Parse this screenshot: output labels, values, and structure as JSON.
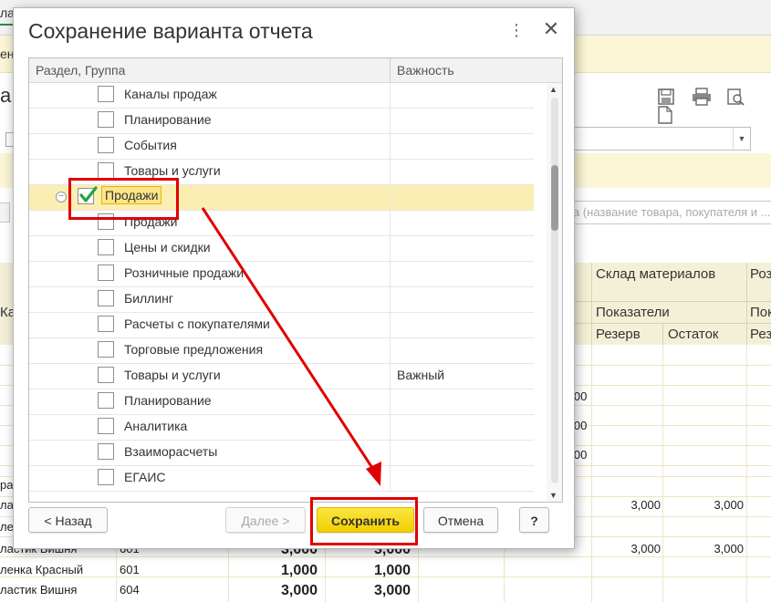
{
  "background": {
    "tab_label": "ла",
    "yellow_bar_text": "ен",
    "title_fragment": "а",
    "search_placeholder": "а (название товара, покупателя и ...",
    "grid_header": {
      "col_left": "Кар",
      "col_warehouse": "Склад материалов",
      "col_r": "Роз",
      "indicators": "Показатели",
      "indicators_r": "Пок",
      "reserve": "Резерв",
      "balance": "Остаток",
      "reserve_r": "Рез"
    },
    "rows": [
      {
        "name": "ра",
        "code": "",
        "v1": "",
        "v2": "",
        "w1": "",
        "w2": ""
      },
      {
        "name": "ла",
        "code": "",
        "v1": "",
        "v2": "",
        "w1": "3,000",
        "w2": "3,000"
      },
      {
        "name": "ле",
        "code": "",
        "v1": "",
        "v2": "",
        "w1": "",
        "w2": ""
      },
      {
        "name": "ластик Вишня",
        "code": "601",
        "v1": "3,000",
        "v2": "3,000",
        "w1": "3,000",
        "w2": "3,000"
      },
      {
        "name": "ленка Красный",
        "code": "601",
        "v1": "1,000",
        "v2": "1,000",
        "w1": "",
        "w2": ""
      },
      {
        "name": "ластик Вишня",
        "code": "604",
        "v1": "3,000",
        "v2": "3,000",
        "w1": "",
        "w2": ""
      }
    ],
    "partial_values": [
      ",000",
      ",000",
      ",000"
    ]
  },
  "dialog": {
    "title": "Сохранение варианта отчета",
    "more_icon": "⋮",
    "close_icon": "✕",
    "columns": {
      "section": "Раздел, Группа",
      "importance": "Важность"
    },
    "rows": [
      {
        "label": "Каналы продаж",
        "checked": false,
        "importance": "",
        "level": 2
      },
      {
        "label": "Планирование",
        "checked": false,
        "importance": "",
        "level": 2
      },
      {
        "label": "События",
        "checked": false,
        "importance": "",
        "level": 2
      },
      {
        "label": "Товары и услуги",
        "checked": false,
        "importance": "",
        "level": 2
      },
      {
        "label": "Продажи",
        "checked": true,
        "importance": "",
        "level": 1,
        "selected": true
      },
      {
        "label": "Продажи",
        "checked": false,
        "importance": "",
        "level": 2
      },
      {
        "label": "Цены и скидки",
        "checked": false,
        "importance": "",
        "level": 2
      },
      {
        "label": "Розничные продажи",
        "checked": false,
        "importance": "",
        "level": 2
      },
      {
        "label": "Биллинг",
        "checked": false,
        "importance": "",
        "level": 2
      },
      {
        "label": "Расчеты с покупателями",
        "checked": false,
        "importance": "",
        "level": 2
      },
      {
        "label": "Торговые предложения",
        "checked": false,
        "importance": "",
        "level": 2
      },
      {
        "label": "Товары и услуги",
        "checked": false,
        "importance": "Важный",
        "level": 2
      },
      {
        "label": "Планирование",
        "checked": false,
        "importance": "",
        "level": 2
      },
      {
        "label": "Аналитика",
        "checked": false,
        "importance": "",
        "level": 2
      },
      {
        "label": "Взаиморасчеты",
        "checked": false,
        "importance": "",
        "level": 2
      },
      {
        "label": "ЕГАИС",
        "checked": false,
        "importance": "",
        "level": 2
      }
    ],
    "buttons": {
      "back": "< Назад",
      "next": "Далее >",
      "save": "Сохранить",
      "cancel": "Отмена",
      "help": "?"
    }
  },
  "colors": {
    "accent_yellow": "#f6d800",
    "selection": "#fbeeb2",
    "annotation_red": "#e00000",
    "check_green": "#2aa13a"
  }
}
